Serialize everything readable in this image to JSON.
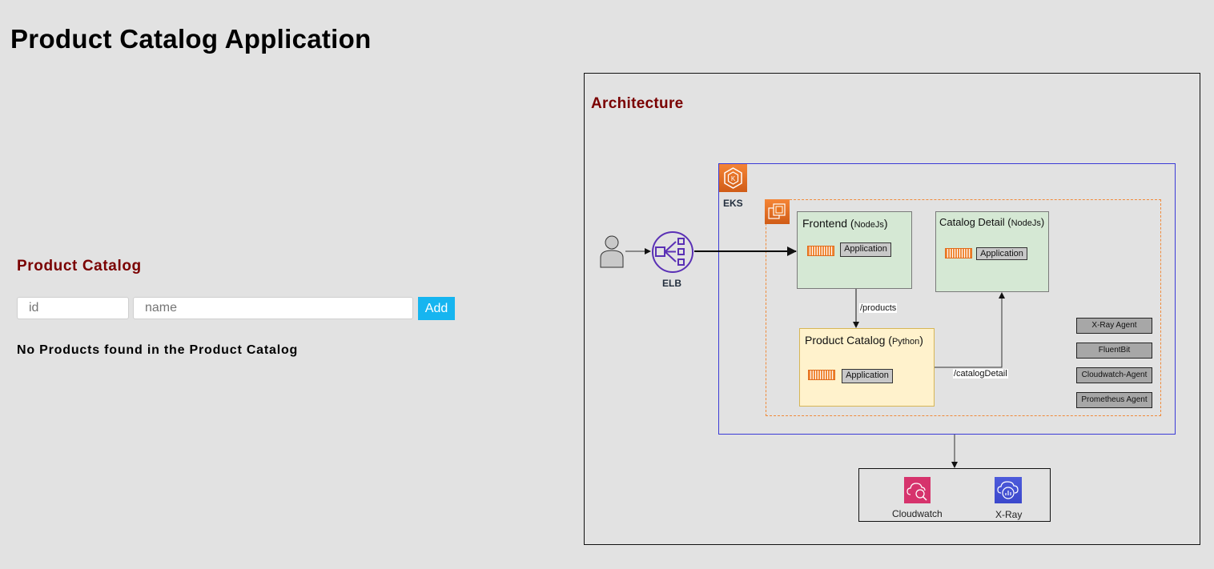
{
  "page": {
    "title": "Product Catalog Application"
  },
  "catalog": {
    "heading": "Product Catalog",
    "id_placeholder": "id",
    "name_placeholder": "name",
    "add_label": "Add",
    "empty_message": "No Products found in the Product Catalog"
  },
  "architecture": {
    "title": "Architecture",
    "user_icon": "user-icon",
    "elb": {
      "label": "ELB",
      "icon": "load-balancer-icon"
    },
    "eks": {
      "label": "EKS",
      "icon": "kubernetes-icon"
    },
    "node_group_icon": "ec2-instance-icon",
    "services": [
      {
        "name": "Frontend",
        "runtime": "NodeJs",
        "app_label": "Application"
      },
      {
        "name": "Catalog Detail",
        "runtime": "NodeJs",
        "app_label": "Application"
      },
      {
        "name": "Product Catalog",
        "runtime": "Python",
        "app_label": "Application"
      }
    ],
    "routes": {
      "products": "/products",
      "catalog_detail": "/catalogDetail"
    },
    "agents": [
      "X-Ray Agent",
      "FluentBit",
      "Cloudwatch-Agent",
      "Prometheus Agent"
    ],
    "monitoring": [
      {
        "label": "Cloudwatch",
        "icon": "cloudwatch-icon",
        "color": "#d6336c"
      },
      {
        "label": "X-Ray",
        "icon": "xray-icon",
        "color": "#3b48cc"
      }
    ],
    "colors": {
      "eks_border": "#3b3bd6",
      "node_group_border": "#f08a3a",
      "elb": "#5a30b5",
      "aws_orange": "#e8741f"
    }
  }
}
